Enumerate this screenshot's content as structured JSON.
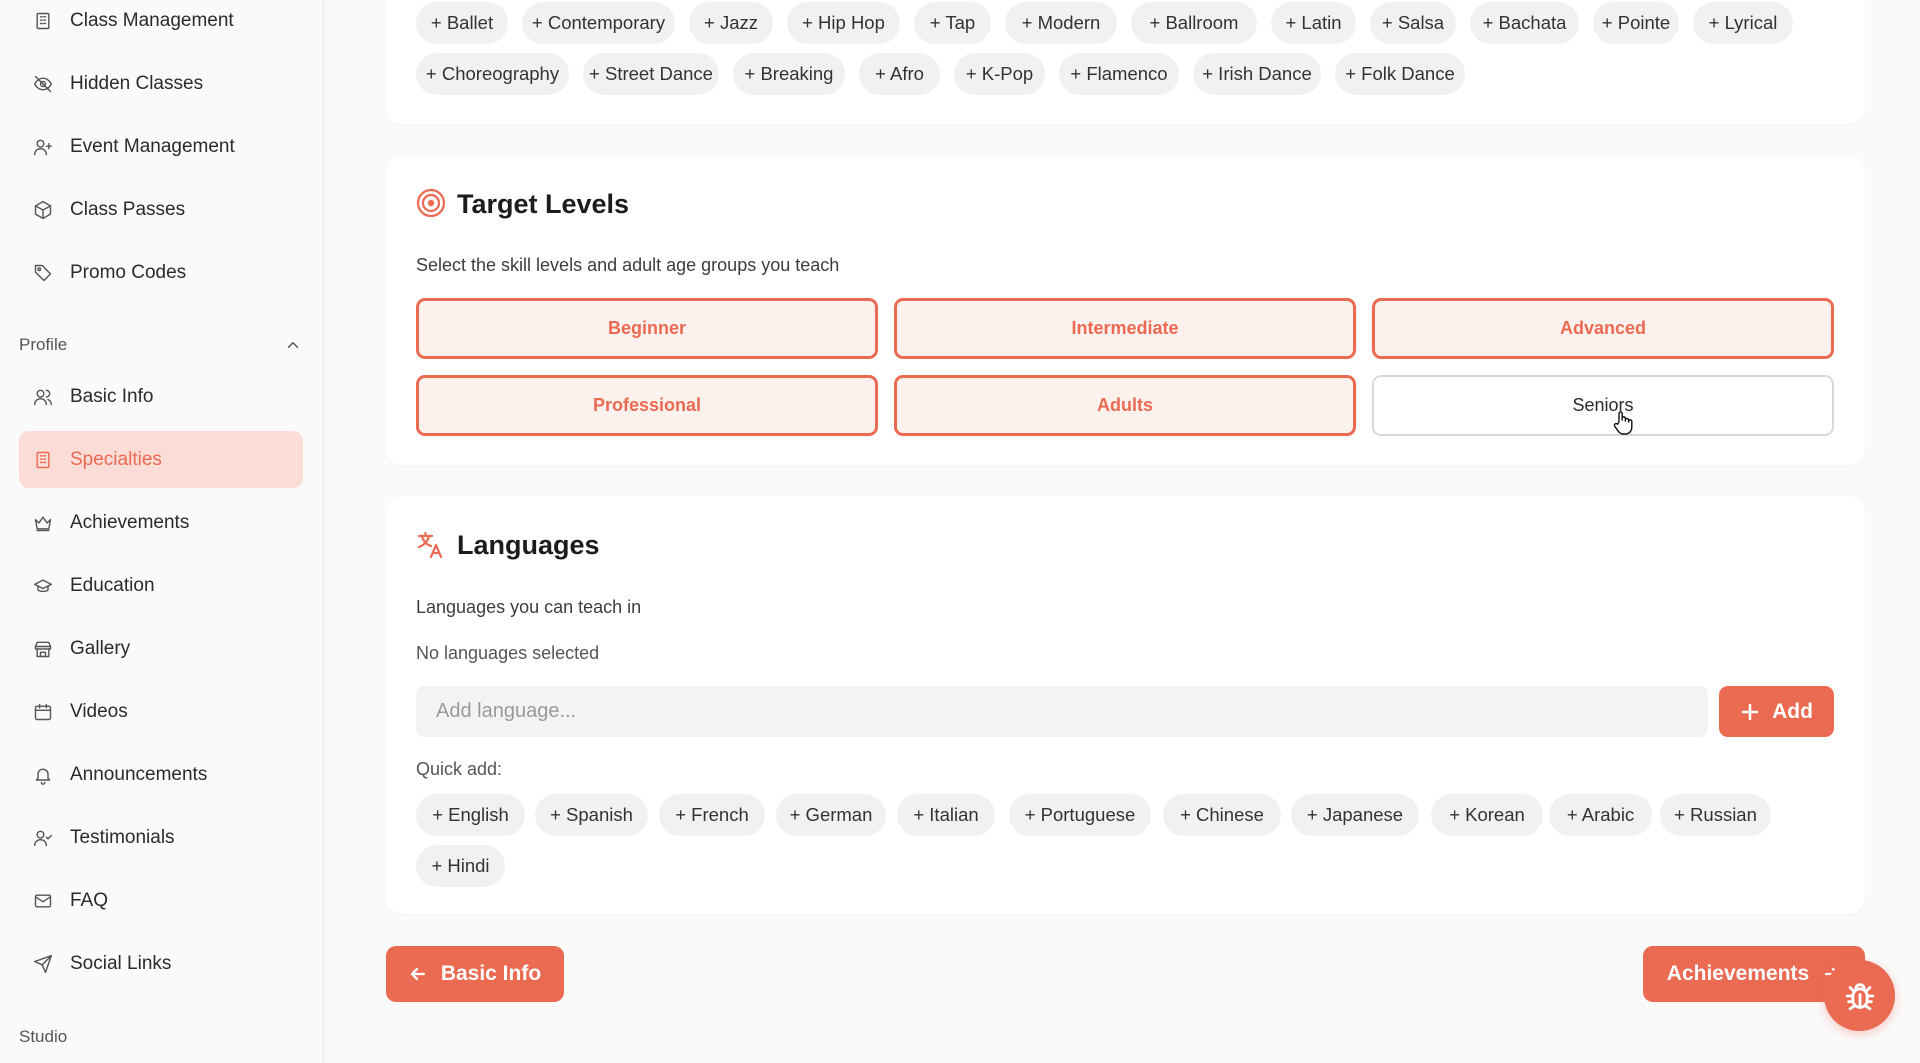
{
  "sidebar": {
    "items_top": [
      {
        "label": "Class Management",
        "icon": "building-icon"
      },
      {
        "label": "Hidden Classes",
        "icon": "eye-off-icon"
      },
      {
        "label": "Event Management",
        "icon": "user-plus-icon"
      },
      {
        "label": "Class Passes",
        "icon": "package-icon"
      },
      {
        "label": "Promo Codes",
        "icon": "tag-icon"
      }
    ],
    "profile_heading": "Profile",
    "profile_items": [
      {
        "label": "Basic Info",
        "icon": "users-icon"
      },
      {
        "label": "Specialties",
        "icon": "building-icon",
        "active": true
      },
      {
        "label": "Achievements",
        "icon": "crown-icon"
      },
      {
        "label": "Education",
        "icon": "graduation-cap-icon"
      },
      {
        "label": "Gallery",
        "icon": "store-icon"
      },
      {
        "label": "Videos",
        "icon": "calendar-icon"
      },
      {
        "label": "Announcements",
        "icon": "bell-icon"
      },
      {
        "label": "Testimonials",
        "icon": "user-check-icon"
      },
      {
        "label": "FAQ",
        "icon": "mail-icon"
      },
      {
        "label": "Social Links",
        "icon": "send-icon"
      }
    ],
    "studio_heading": "Studio"
  },
  "styles": {
    "chips_row1": [
      "+ Ballet",
      "+ Contemporary",
      "+ Jazz",
      "+ Hip Hop",
      "+ Tap",
      "+ Modern",
      "+ Ballroom",
      "+ Latin",
      "+ Salsa",
      "+ Bachata",
      "+ Pointe",
      "+ Lyrical"
    ],
    "chips_row2": [
      "+ Choreography",
      "+ Street Dance",
      "+ Breaking",
      "+ Afro",
      "+ K-Pop",
      "+ Flamenco",
      "+ Irish Dance",
      "+ Folk Dance"
    ]
  },
  "target_levels": {
    "title": "Target Levels",
    "subtitle": "Select the skill levels and adult age groups you teach",
    "options": [
      {
        "label": "Beginner",
        "selected": true
      },
      {
        "label": "Intermediate",
        "selected": true
      },
      {
        "label": "Advanced",
        "selected": true
      },
      {
        "label": "Professional",
        "selected": true
      },
      {
        "label": "Adults",
        "selected": true
      },
      {
        "label": "Seniors",
        "selected": false
      }
    ]
  },
  "languages": {
    "title": "Languages",
    "subtitle": "Languages you can teach in",
    "empty_text": "No languages selected",
    "input_placeholder": "Add language...",
    "add_label": "Add",
    "quick_add_label": "Quick add:",
    "chips_row1": [
      "+ English",
      "+ Spanish",
      "+ French",
      "+ German",
      "+ Italian",
      "+ Portuguese",
      "+ Chinese",
      "+ Japanese",
      "+ Korean",
      "+ Arabic",
      "+ Russian"
    ],
    "chips_row2": [
      "+ Hindi"
    ]
  },
  "footer": {
    "prev_label": "Basic Info",
    "next_label": "Achievements"
  },
  "colors": {
    "accent": "#ea6a52",
    "active_bg": "#fbdcd6",
    "selected_bg": "#fdf1ee"
  }
}
